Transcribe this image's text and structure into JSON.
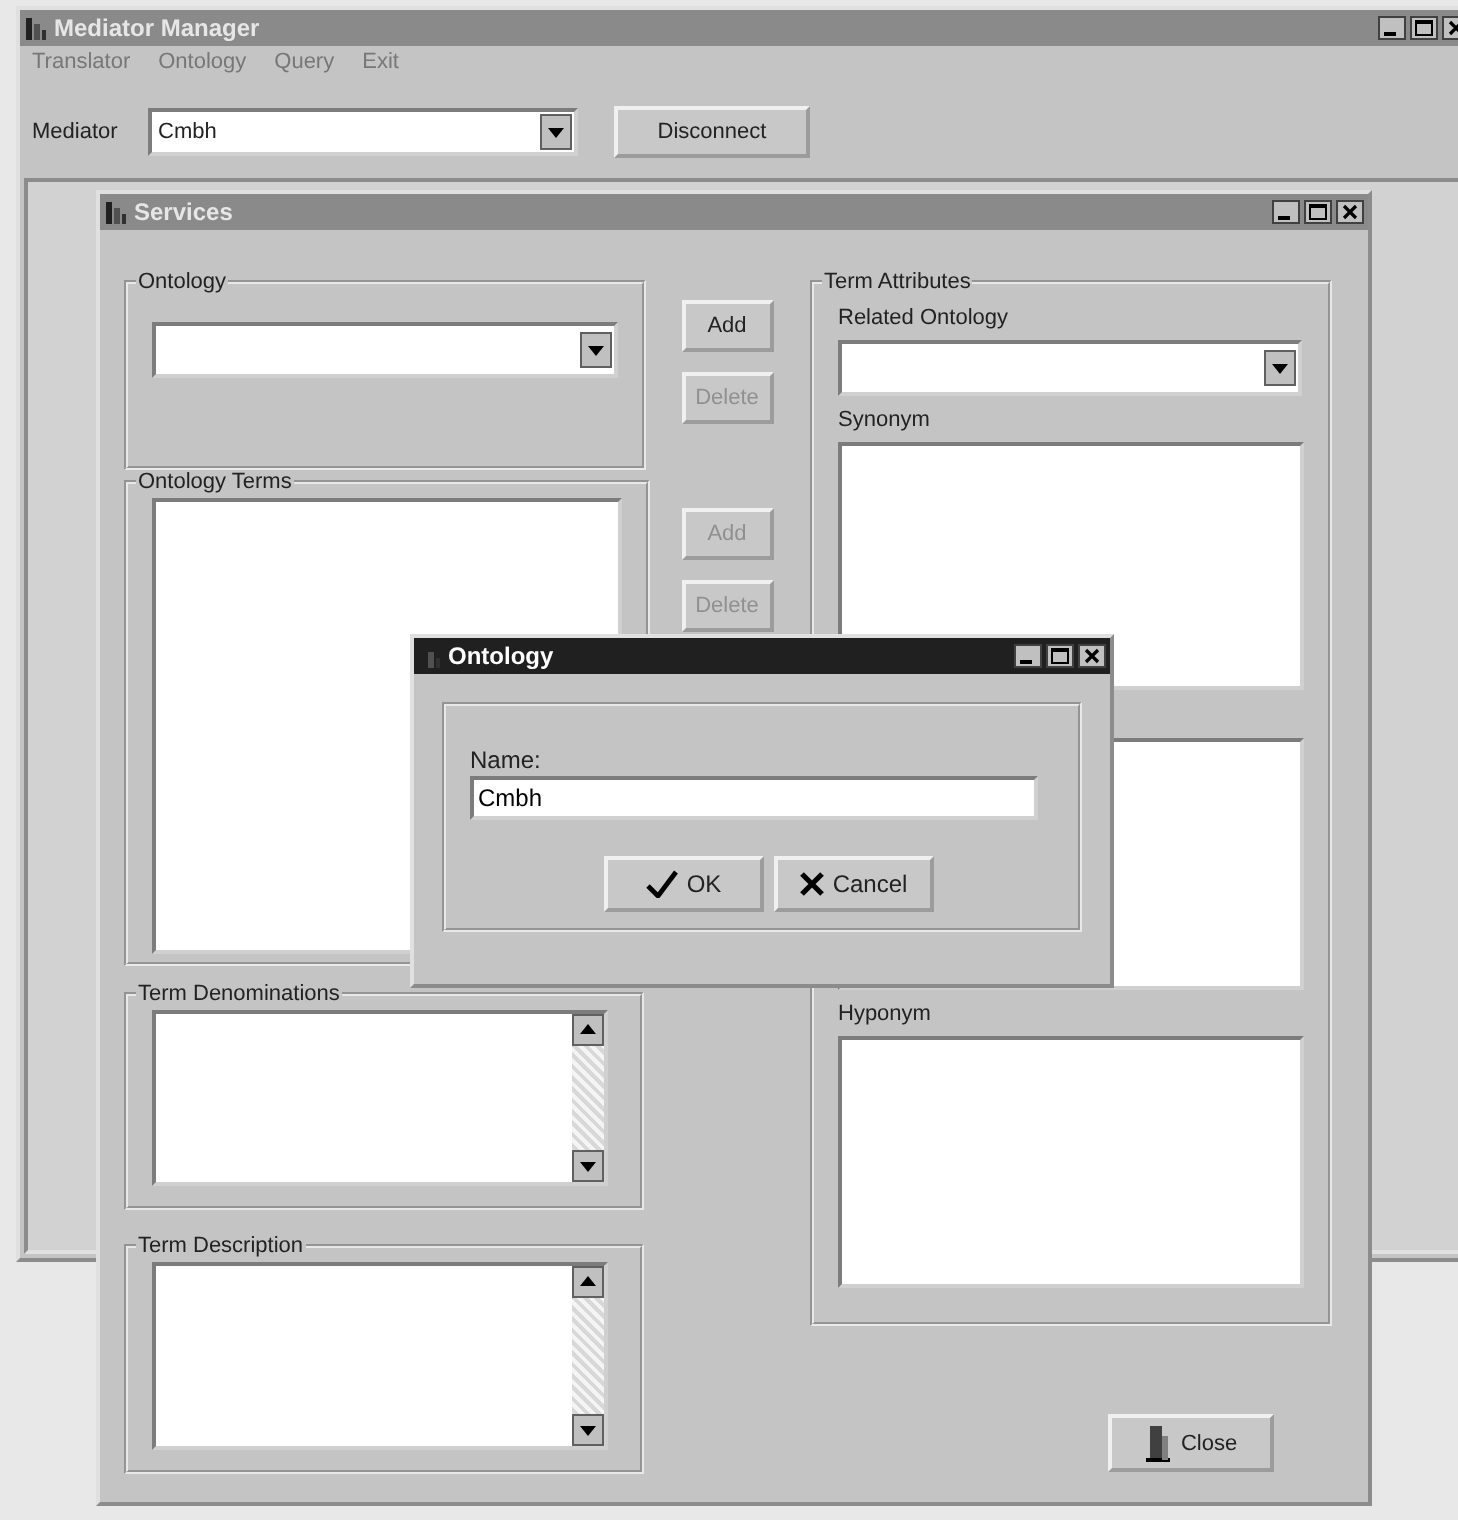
{
  "main_window": {
    "title": "Mediator Manager",
    "active": false,
    "menu": [
      "Translator",
      "Ontology",
      "Query",
      "Exit"
    ],
    "mediator": {
      "label": "Mediator",
      "value": "Cmbh"
    },
    "disconnect_button": "Disconnect"
  },
  "services_window": {
    "title": "Services",
    "active": false,
    "ontology_group": {
      "title": "Ontology"
    },
    "ontology_buttons": [
      {
        "label": "Add",
        "disabled": false
      },
      {
        "label": "Delete",
        "disabled": true
      }
    ],
    "terms_group": {
      "title": "Ontology Terms"
    },
    "term_buttons": [
      {
        "label": "Add",
        "disabled": true
      },
      {
        "label": "Delete",
        "disabled": true
      }
    ],
    "denominations_group": {
      "title": "Term Denominations"
    },
    "description_group": {
      "title": "Term Description"
    },
    "attributes_group": {
      "title": "Term Attributes",
      "related_label": "Related Ontology",
      "synonym_label": "Synonym",
      "hyponym_label": "Hyponym"
    },
    "close_button": "Close"
  },
  "dialog": {
    "title": "Ontology",
    "active": true,
    "name_label": "Name:",
    "name_value": "Cmbh",
    "buttons": [
      {
        "kind": "ok",
        "label": "OK"
      },
      {
        "kind": "cancel",
        "label": "Cancel"
      }
    ]
  }
}
